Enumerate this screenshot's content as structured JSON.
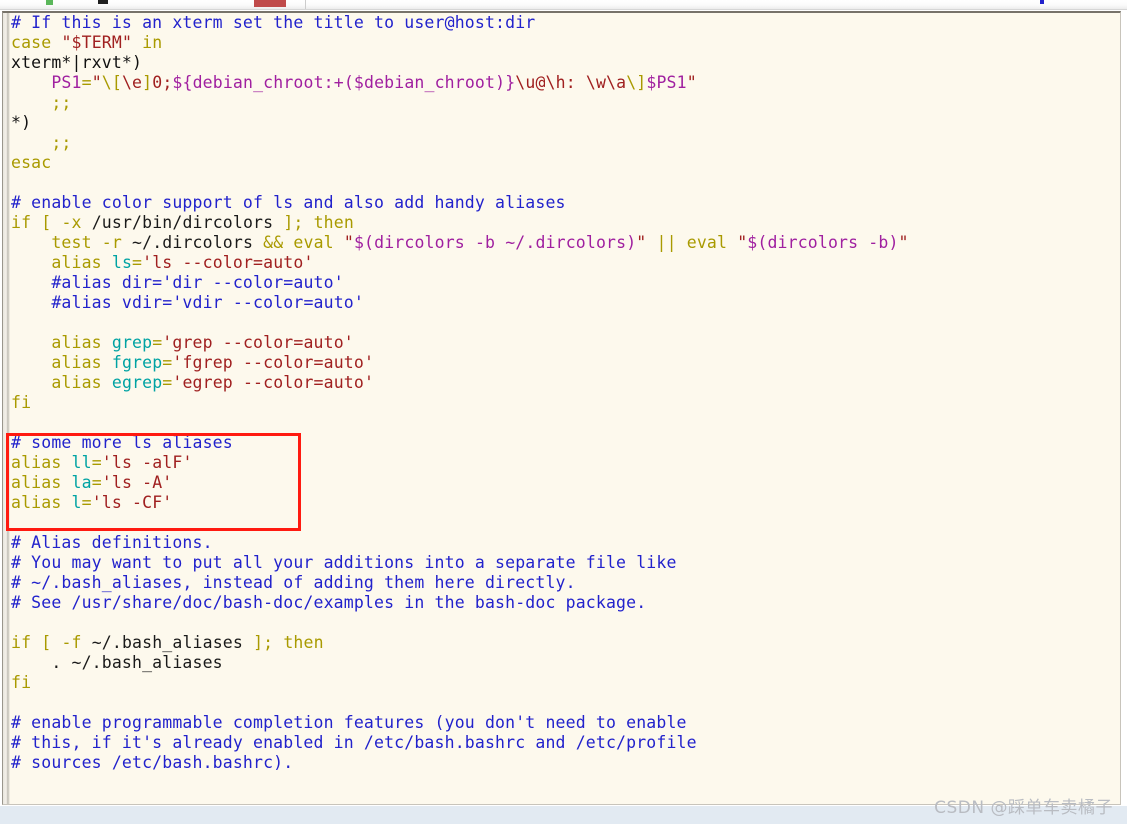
{
  "toolbar": {
    "icons": [
      {
        "name": "green-marker-icon"
      },
      {
        "name": "black-marker-icon"
      },
      {
        "name": "red-block-icon"
      },
      {
        "name": "toolbar-separator"
      },
      {
        "name": "blue-dot-icon"
      }
    ]
  },
  "editor": {
    "file_kind": "bash-rc-script",
    "background_color": "#fdf9ed",
    "palette": {
      "comment": "#2222cc",
      "keyword": "#a99a00",
      "variable": "#00a3a3",
      "string": "#a02020",
      "shell_var": "#a020a0",
      "plain": "#1a1a1a",
      "highlight_box": "#ff1a10"
    },
    "lines": [
      {
        "n": 1,
        "tokens": [
          {
            "t": "cmt",
            "s": "# If this is an xterm set the title to user@host:dir"
          }
        ]
      },
      {
        "n": 2,
        "tokens": [
          {
            "t": "kw",
            "s": "case"
          },
          {
            "t": "pln",
            "s": " "
          },
          {
            "t": "str",
            "s": "\"$TERM\""
          },
          {
            "t": "pln",
            "s": " "
          },
          {
            "t": "kw",
            "s": "in"
          }
        ]
      },
      {
        "n": 3,
        "tokens": [
          {
            "t": "blk",
            "s": "xterm*|rxvt*)"
          }
        ]
      },
      {
        "n": 4,
        "tokens": [
          {
            "t": "pln",
            "s": "    "
          },
          {
            "t": "mag",
            "s": "PS1"
          },
          {
            "t": "kw",
            "s": "="
          },
          {
            "t": "str",
            "s": "\""
          },
          {
            "t": "kw",
            "s": "\\["
          },
          {
            "t": "str",
            "s": "\\e"
          },
          {
            "t": "kw",
            "s": "]"
          },
          {
            "t": "str",
            "s": "0;"
          },
          {
            "t": "mag",
            "s": "${debian_chroot:+("
          },
          {
            "t": "mag",
            "s": "$debian_chroot"
          },
          {
            "t": "mag",
            "s": ")}"
          },
          {
            "t": "str",
            "s": "\\u@\\h: \\w\\a"
          },
          {
            "t": "kw",
            "s": "\\]"
          },
          {
            "t": "mag",
            "s": "$PS1"
          },
          {
            "t": "str",
            "s": "\""
          }
        ]
      },
      {
        "n": 5,
        "tokens": [
          {
            "t": "pln",
            "s": "    "
          },
          {
            "t": "kw",
            "s": ";;"
          }
        ]
      },
      {
        "n": 6,
        "tokens": [
          {
            "t": "blk",
            "s": "*)"
          }
        ]
      },
      {
        "n": 7,
        "tokens": [
          {
            "t": "pln",
            "s": "    "
          },
          {
            "t": "kw",
            "s": ";;"
          }
        ]
      },
      {
        "n": 8,
        "tokens": [
          {
            "t": "kw",
            "s": "esac"
          }
        ]
      },
      {
        "n": 9,
        "tokens": [
          {
            "t": "pln",
            "s": ""
          }
        ]
      },
      {
        "n": 10,
        "tokens": [
          {
            "t": "cmt",
            "s": "# enable color support of ls and also add handy aliases"
          }
        ]
      },
      {
        "n": 11,
        "tokens": [
          {
            "t": "kw",
            "s": "if"
          },
          {
            "t": "pln",
            "s": " "
          },
          {
            "t": "kw",
            "s": "["
          },
          {
            "t": "pln",
            "s": " "
          },
          {
            "t": "kw",
            "s": "-x"
          },
          {
            "t": "pln",
            "s": " /usr/bin/dircolors "
          },
          {
            "t": "kw",
            "s": "];"
          },
          {
            "t": "pln",
            "s": " "
          },
          {
            "t": "kw",
            "s": "then"
          }
        ]
      },
      {
        "n": 12,
        "tokens": [
          {
            "t": "pln",
            "s": "    "
          },
          {
            "t": "kw",
            "s": "test"
          },
          {
            "t": "pln",
            "s": " "
          },
          {
            "t": "kw",
            "s": "-r"
          },
          {
            "t": "pln",
            "s": " ~/.dircolors "
          },
          {
            "t": "kw",
            "s": "&&"
          },
          {
            "t": "pln",
            "s": " "
          },
          {
            "t": "kw",
            "s": "eval"
          },
          {
            "t": "pln",
            "s": " "
          },
          {
            "t": "str",
            "s": "\""
          },
          {
            "t": "mag",
            "s": "$(dircolors -b ~/.dircolors)"
          },
          {
            "t": "str",
            "s": "\""
          },
          {
            "t": "pln",
            "s": " "
          },
          {
            "t": "kw",
            "s": "||"
          },
          {
            "t": "pln",
            "s": " "
          },
          {
            "t": "kw",
            "s": "eval"
          },
          {
            "t": "pln",
            "s": " "
          },
          {
            "t": "str",
            "s": "\""
          },
          {
            "t": "mag",
            "s": "$(dircolors -b)"
          },
          {
            "t": "str",
            "s": "\""
          }
        ]
      },
      {
        "n": 13,
        "tokens": [
          {
            "t": "pln",
            "s": "    "
          },
          {
            "t": "kw",
            "s": "alias"
          },
          {
            "t": "pln",
            "s": " "
          },
          {
            "t": "var",
            "s": "ls"
          },
          {
            "t": "kw",
            "s": "="
          },
          {
            "t": "str",
            "s": "'ls --color=auto'"
          }
        ]
      },
      {
        "n": 14,
        "tokens": [
          {
            "t": "pln",
            "s": "    "
          },
          {
            "t": "cmt",
            "s": "#alias dir='dir --color=auto'"
          }
        ]
      },
      {
        "n": 15,
        "tokens": [
          {
            "t": "pln",
            "s": "    "
          },
          {
            "t": "cmt",
            "s": "#alias vdir='vdir --color=auto'"
          }
        ]
      },
      {
        "n": 16,
        "tokens": [
          {
            "t": "pln",
            "s": ""
          }
        ]
      },
      {
        "n": 17,
        "tokens": [
          {
            "t": "pln",
            "s": "    "
          },
          {
            "t": "kw",
            "s": "alias"
          },
          {
            "t": "pln",
            "s": " "
          },
          {
            "t": "var",
            "s": "grep"
          },
          {
            "t": "kw",
            "s": "="
          },
          {
            "t": "str",
            "s": "'grep --color=auto'"
          }
        ]
      },
      {
        "n": 18,
        "tokens": [
          {
            "t": "pln",
            "s": "    "
          },
          {
            "t": "kw",
            "s": "alias"
          },
          {
            "t": "pln",
            "s": " "
          },
          {
            "t": "var",
            "s": "fgrep"
          },
          {
            "t": "kw",
            "s": "="
          },
          {
            "t": "str",
            "s": "'fgrep --color=auto'"
          }
        ]
      },
      {
        "n": 19,
        "tokens": [
          {
            "t": "pln",
            "s": "    "
          },
          {
            "t": "kw",
            "s": "alias"
          },
          {
            "t": "pln",
            "s": " "
          },
          {
            "t": "var",
            "s": "egrep"
          },
          {
            "t": "kw",
            "s": "="
          },
          {
            "t": "str",
            "s": "'egrep --color=auto'"
          }
        ]
      },
      {
        "n": 20,
        "tokens": [
          {
            "t": "kw",
            "s": "fi"
          }
        ]
      },
      {
        "n": 21,
        "tokens": [
          {
            "t": "pln",
            "s": ""
          }
        ]
      },
      {
        "n": 22,
        "tokens": [
          {
            "t": "cmt",
            "s": "# some more ls aliases"
          }
        ]
      },
      {
        "n": 23,
        "tokens": [
          {
            "t": "kw",
            "s": "alias"
          },
          {
            "t": "pln",
            "s": " "
          },
          {
            "t": "var",
            "s": "ll"
          },
          {
            "t": "kw",
            "s": "="
          },
          {
            "t": "str",
            "s": "'ls -alF'"
          }
        ]
      },
      {
        "n": 24,
        "tokens": [
          {
            "t": "kw",
            "s": "alias"
          },
          {
            "t": "pln",
            "s": " "
          },
          {
            "t": "var",
            "s": "la"
          },
          {
            "t": "kw",
            "s": "="
          },
          {
            "t": "str",
            "s": "'ls -A'"
          }
        ]
      },
      {
        "n": 25,
        "tokens": [
          {
            "t": "kw",
            "s": "alias"
          },
          {
            "t": "pln",
            "s": " "
          },
          {
            "t": "var",
            "s": "l"
          },
          {
            "t": "kw",
            "s": "="
          },
          {
            "t": "str",
            "s": "'ls -CF'"
          }
        ]
      },
      {
        "n": 26,
        "tokens": [
          {
            "t": "pln",
            "s": ""
          }
        ]
      },
      {
        "n": 27,
        "tokens": [
          {
            "t": "cmt",
            "s": "# Alias definitions."
          }
        ]
      },
      {
        "n": 28,
        "tokens": [
          {
            "t": "cmt",
            "s": "# You may want to put all your additions into a separate file like"
          }
        ]
      },
      {
        "n": 29,
        "tokens": [
          {
            "t": "cmt",
            "s": "# ~/.bash_aliases, instead of adding them here directly."
          }
        ]
      },
      {
        "n": 30,
        "tokens": [
          {
            "t": "cmt",
            "s": "# See /usr/share/doc/bash-doc/examples in the bash-doc package."
          }
        ]
      },
      {
        "n": 31,
        "tokens": [
          {
            "t": "pln",
            "s": ""
          }
        ]
      },
      {
        "n": 32,
        "tokens": [
          {
            "t": "kw",
            "s": "if"
          },
          {
            "t": "pln",
            "s": " "
          },
          {
            "t": "kw",
            "s": "["
          },
          {
            "t": "pln",
            "s": " "
          },
          {
            "t": "kw",
            "s": "-f"
          },
          {
            "t": "pln",
            "s": " ~/.bash_aliases "
          },
          {
            "t": "kw",
            "s": "];"
          },
          {
            "t": "pln",
            "s": " "
          },
          {
            "t": "kw",
            "s": "then"
          }
        ]
      },
      {
        "n": 33,
        "tokens": [
          {
            "t": "pln",
            "s": "    . ~/.bash_aliases"
          }
        ]
      },
      {
        "n": 34,
        "tokens": [
          {
            "t": "kw",
            "s": "fi"
          }
        ]
      },
      {
        "n": 35,
        "tokens": [
          {
            "t": "pln",
            "s": ""
          }
        ]
      },
      {
        "n": 36,
        "tokens": [
          {
            "t": "cmt",
            "s": "# enable programmable completion features (you don't need to enable"
          }
        ]
      },
      {
        "n": 37,
        "tokens": [
          {
            "t": "cmt",
            "s": "# this, if it's already enabled in /etc/bash.bashrc and /etc/profile"
          }
        ]
      },
      {
        "n": 38,
        "tokens": [
          {
            "t": "cmt",
            "s": "# sources /etc/bash.bashrc)."
          }
        ]
      }
    ]
  },
  "highlight_box": {
    "label": "some-more-ls-aliases-highlight",
    "color": "#ff1a10",
    "covers_lines": "22-25"
  },
  "watermark": {
    "text": "CSDN @踩单车卖橘子"
  }
}
